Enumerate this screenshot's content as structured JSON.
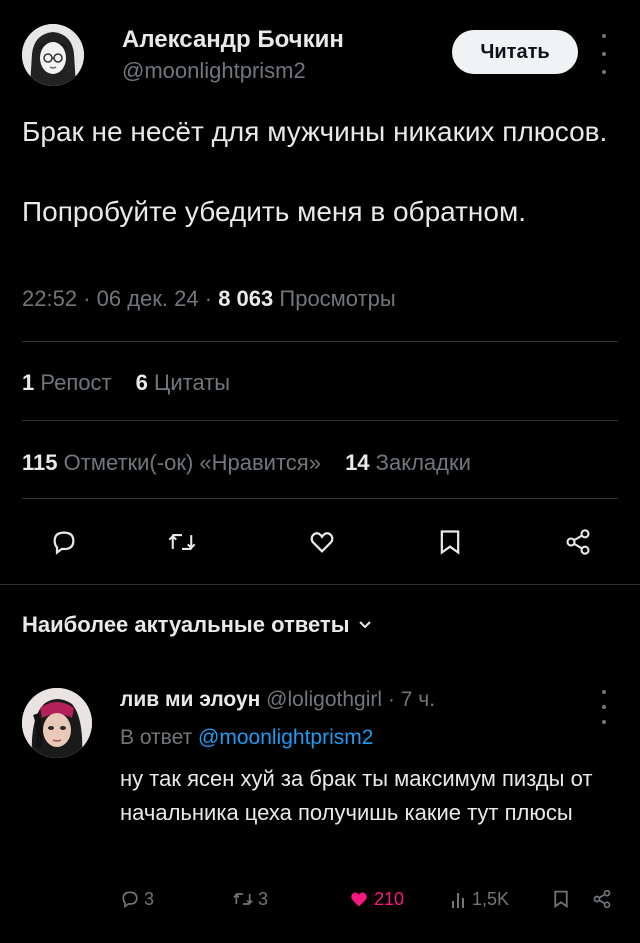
{
  "author": {
    "name": "Александр Бочкин",
    "handle": "@moonlightprism2"
  },
  "follow_button": "Читать",
  "post": {
    "line1": "Брак не несёт для мужчины никаких плюсов.",
    "line2": "Попробуйте убедить меня в обратном.",
    "time": "22:52",
    "sep1": "·",
    "date": "06 дек. 24",
    "sep2": "·",
    "views_count": "8 063",
    "views_label": "Просмотры"
  },
  "stats": {
    "reposts_count": "1",
    "reposts_label": "Репост",
    "quotes_count": "6",
    "quotes_label": "Цитаты",
    "likes_count": "115",
    "likes_label": "Отметки(-ок) «Нравится»",
    "bookmarks_count": "14",
    "bookmarks_label": "Закладки"
  },
  "icons": {
    "reply": "comment-icon",
    "retweet": "retweet-icon",
    "like": "heart-icon",
    "bookmark": "bookmark-icon",
    "share": "share-icon"
  },
  "sort_label": "Наиболее актуальные ответы",
  "reply": {
    "name": "лив ми элоун",
    "handle": "@loligothgirl",
    "sep": "·",
    "time": "7 ч.",
    "reply_to_prefix": "В ответ",
    "reply_to_handle": "@moonlightprism2",
    "text": "ну так ясен хуй за брак ты максимум пизды от начальника цеха получишь какие тут плюсы",
    "replies": "3",
    "retweets": "3",
    "likes": "210",
    "views": "1,5K"
  },
  "colors": {
    "background": "#000000",
    "text": "#e7e9ea",
    "muted": "#71767b",
    "link": "#1d9bf0",
    "like": "#f91880",
    "divider": "#2f3336"
  }
}
